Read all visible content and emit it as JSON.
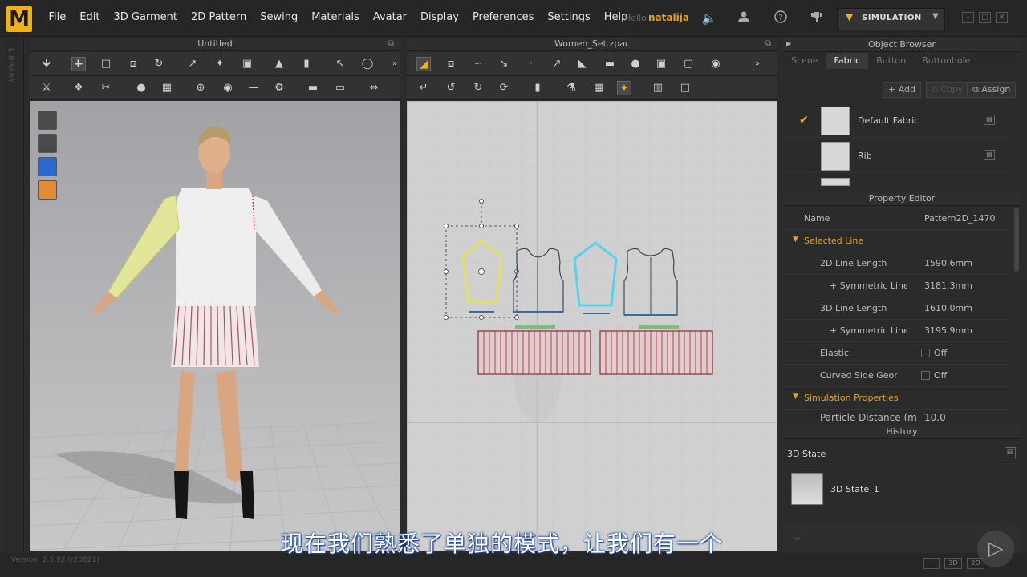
{
  "app": {
    "logo": "M"
  },
  "menu": [
    "File",
    "Edit",
    "3D Garment",
    "2D Pattern",
    "Sewing",
    "Materials",
    "Avatar",
    "Display",
    "Preferences",
    "Settings",
    "Help"
  ],
  "user": {
    "greeting": "Hello",
    "name": "natalija"
  },
  "simulation": {
    "label": "SIMULATION"
  },
  "library_label": "LIBRARY",
  "viewport3d": {
    "title": "Untitled"
  },
  "viewport2d": {
    "title": "Women_Set.zpac"
  },
  "object_browser": {
    "title": "Object Browser",
    "tabs": [
      "Scene",
      "Fabric",
      "Button",
      "Buttonhole"
    ],
    "active_tab": "Fabric",
    "buttons": {
      "add": "Add",
      "copy": "Copy",
      "assign": "Assign"
    },
    "fabrics": [
      {
        "name": "Default Fabric",
        "checked": true
      },
      {
        "name": "Rib",
        "checked": false
      }
    ]
  },
  "property_editor": {
    "title": "Property Editor",
    "name_label": "Name",
    "name_value": "Pattern2D_1470",
    "selected_line": "Selected Line",
    "rows": [
      {
        "label": "2D Line Length",
        "value": "1590.6mm"
      },
      {
        "label": "+ Symmetric Line Le",
        "value": "3181.3mm"
      },
      {
        "label": "3D Line Length",
        "value": "1610.0mm"
      },
      {
        "label": "+ Symmetric Line Le",
        "value": "3195.9mm"
      },
      {
        "label": "Elastic",
        "value": "Off"
      },
      {
        "label": "Curved Side Geome",
        "value": "Off"
      }
    ],
    "simulation_properties": "Simulation Properties",
    "cut_row": {
      "label": "Particle Distance (m",
      "value": "10.0"
    }
  },
  "history": {
    "title": "History",
    "state_header": "3D State",
    "items": [
      "3D State_1"
    ]
  },
  "status": {
    "version": "Version: 2.5.92    (r23021)"
  },
  "subtitle": "现在我们熟悉了单独的模式，让我们有一个",
  "colors": {
    "accent": "#f0b21a",
    "selected_pattern": "#e4e44a",
    "highlight_pattern": "#4ad0f0",
    "section": "#e8a020"
  }
}
